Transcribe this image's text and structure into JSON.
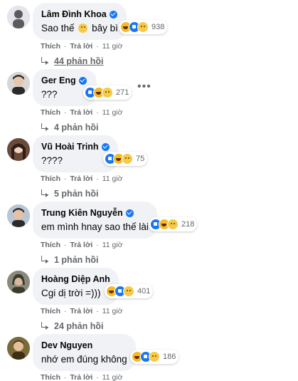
{
  "labels": {
    "like": "Thích",
    "reply": "Trả lời",
    "separator": "·"
  },
  "colors": {
    "bubble": "#f0f2f5",
    "verified": "#1877f2",
    "meta": "#65676b",
    "text": "#050505"
  },
  "comments": [
    {
      "author": "Lâm Đình Khoa",
      "text_before": "Sao thế",
      "text_after": "bây bì",
      "has_inline_emoji": true,
      "reactions": [
        "haha",
        "like",
        "sad"
      ],
      "reaction_count": "938",
      "time": "11 giờ",
      "replies": "44 phản hồi",
      "avatar_colors": [
        "#e4e6eb",
        "#5b5b5b"
      ]
    },
    {
      "author": "Ger Eng",
      "text_before": "???",
      "text_after": "",
      "has_inline_emoji": false,
      "reactions": [
        "like",
        "haha",
        "sad"
      ],
      "reaction_count": "271",
      "time": "11 giờ",
      "replies": "4 phản hồi",
      "more_icon": "•••",
      "avatar_colors": [
        "#d7d7d7",
        "#2a2a2a"
      ]
    },
    {
      "author": "Vũ Hoài Trinh",
      "text_before": "????",
      "text_after": "",
      "has_inline_emoji": false,
      "reactions": [
        "like",
        "haha",
        "sad"
      ],
      "reaction_count": "75",
      "time": "11 giờ",
      "replies": "5 phản hồi",
      "avatar_colors": [
        "#6b4a3a",
        "#2d1f19"
      ]
    },
    {
      "author": "Trung Kiên Nguyễn",
      "text_before": "em mình hnay sao thế lài",
      "text_after": "",
      "has_inline_emoji": false,
      "reactions": [
        "like",
        "haha",
        "sad"
      ],
      "reaction_count": "218",
      "time": "11 giờ",
      "replies": "1 phản hồi",
      "avatar_colors": [
        "#b9c6d4",
        "#2b2b2b"
      ]
    },
    {
      "author": "Hoàng Diệp Anh",
      "text_before": "Cgi dị trời =)))",
      "text_after": "",
      "has_inline_emoji": false,
      "reactions": [
        "haha",
        "like",
        "sad"
      ],
      "reaction_count": "401",
      "time": "11 giờ",
      "replies": "24 phản hồi",
      "avatar_colors": [
        "#8a8a7a",
        "#3a3a30"
      ]
    },
    {
      "author": "Dev Nguyen",
      "text_before": "nhớ em đúng không",
      "text_after": "",
      "has_inline_emoji": false,
      "reactions": [
        "haha",
        "like",
        "sad"
      ],
      "reaction_count": "186",
      "time": "11 giờ",
      "replies": "",
      "avatar_colors": [
        "#7a6a3a",
        "#3b2f14"
      ]
    }
  ]
}
